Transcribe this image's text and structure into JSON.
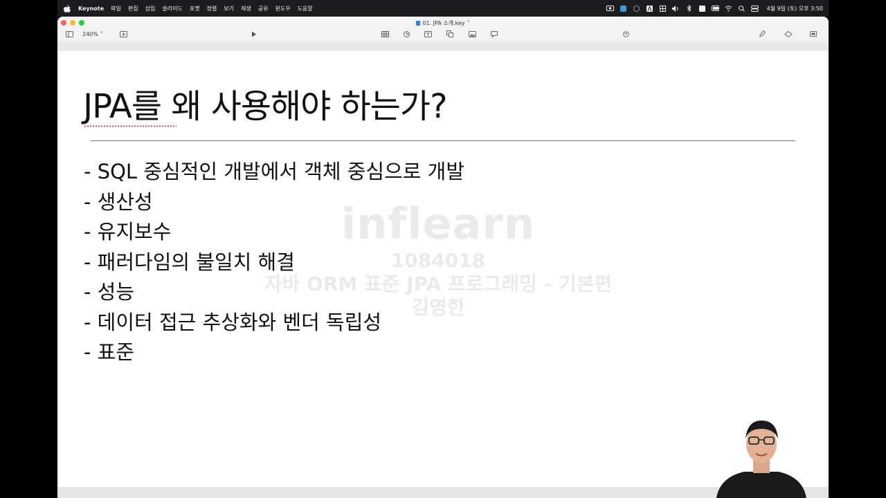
{
  "menubar": {
    "app_name": "Keynote",
    "items": [
      "파일",
      "편집",
      "삽입",
      "슬라이드",
      "포맷",
      "정렬",
      "보기",
      "재생",
      "공유",
      "윈도우",
      "도움말"
    ],
    "clock": "4월 9일 (토) 오후 3:50"
  },
  "window": {
    "document_title": "01. JPA 소개.key",
    "zoom": "240%"
  },
  "slide": {
    "title": "JPA를 왜 사용해야 하는가?",
    "bullets": [
      "- SQL 중심적인 개발에서 객체 중심으로 개발",
      "- 생산성",
      "- 유지보수",
      "- 패러다임의 불일치 해결",
      "- 성능",
      "- 데이터 접근 추상화와 벤더 독립성",
      "- 표준"
    ]
  },
  "watermark": {
    "logo": "inflearn",
    "id": "1084018",
    "course": "자바 ORM 표준 JPA 프로그래밍 - 기본편",
    "author": "김영한"
  },
  "colors": {
    "menubar_bg": "#1d1d1f",
    "spellcheck": "#d63a3a",
    "traffic_close": "#fe5f57",
    "traffic_min": "#febc2e",
    "traffic_max": "#28c840"
  }
}
